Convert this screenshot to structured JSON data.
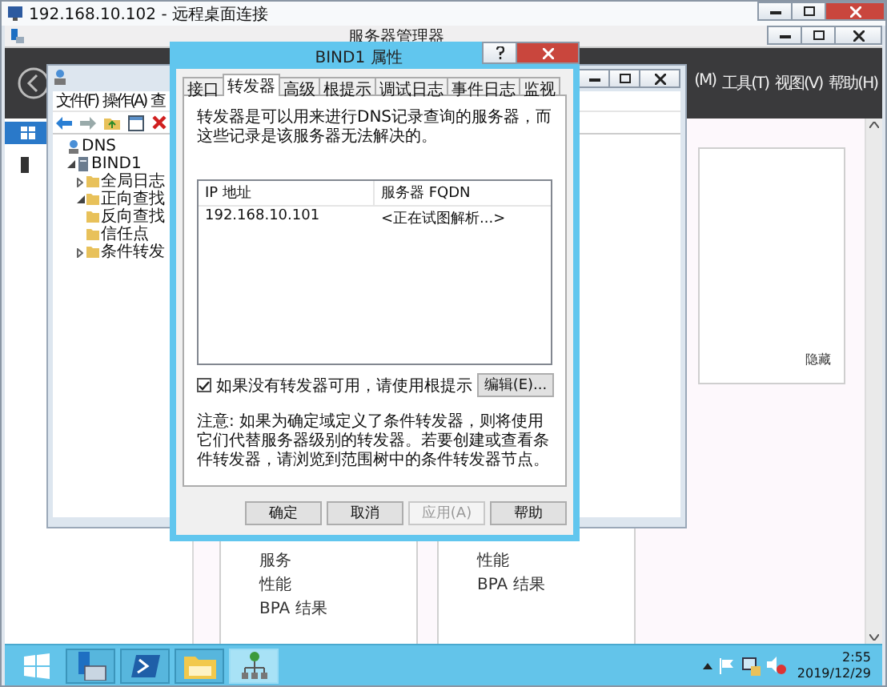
{
  "remote_window": {
    "title": "192.168.10.102 - 远程桌面连接"
  },
  "server_manager": {
    "title": "服务器管理器",
    "menu": [
      "(M)",
      "工具(T)",
      "视图(V)",
      "帮助(H)"
    ],
    "nav": [
      {
        "kind": "dashboard",
        "selected": true
      },
      {
        "kind": "server",
        "selected": false
      }
    ],
    "hide_link": "隐藏",
    "tiles": [
      {
        "items": [
          "服务",
          "性能",
          "BPA 结果"
        ]
      },
      {
        "items": [
          "性能",
          "BPA 结果"
        ]
      }
    ]
  },
  "dns_manager": {
    "menu": [
      "文件(F)",
      "操作(A)",
      "查"
    ],
    "tree": [
      {
        "label": "DNS",
        "kind": "dns",
        "children": [
          {
            "label": "BIND1",
            "kind": "server",
            "expanded": true,
            "children": [
              {
                "label": "全局日志",
                "kind": "folder",
                "expanded": false
              },
              {
                "label": "正向查找",
                "kind": "folder",
                "expanded": true
              },
              {
                "label": "反向查找",
                "kind": "folder"
              },
              {
                "label": "信任点",
                "kind": "folder"
              },
              {
                "label": "条件转发",
                "kind": "folder",
                "expanded": false
              }
            ]
          }
        ]
      }
    ]
  },
  "dialog": {
    "title": "BIND1 属性",
    "tabs": [
      {
        "label": "接口",
        "selected": false
      },
      {
        "label": "转发器",
        "selected": true
      },
      {
        "label": "高级",
        "selected": false
      },
      {
        "label": "根提示",
        "selected": false
      },
      {
        "label": "调试日志",
        "selected": false
      },
      {
        "label": "事件日志",
        "selected": false
      },
      {
        "label": "监视",
        "selected": false
      }
    ],
    "description": "转发器是可以用来进行DNS记录查询的服务器，而这些记录是该服务器无法解决的。",
    "table": {
      "columns": [
        "IP 地址",
        "服务器 FQDN"
      ],
      "rows": [
        [
          "192.168.10.101",
          "<正在试图解析...>"
        ]
      ]
    },
    "use_root_hints": {
      "label": "如果没有转发器可用，请使用根提示",
      "checked": true
    },
    "edit_button": "编辑(E)...",
    "note": "注意: 如果为确定域定义了条件转发器，则将使用它们代替服务器级别的转发器。若要创建或查看条件转发器，请浏览到范围树中的条件转发器节点。",
    "buttons": [
      {
        "label": "确定",
        "disabled": false
      },
      {
        "label": "取消",
        "disabled": false
      },
      {
        "label": "应用(A)",
        "disabled": true
      },
      {
        "label": "帮助",
        "disabled": false
      }
    ]
  },
  "taskbar": {
    "apps": [
      {
        "kind": "server-manager",
        "selected": false
      },
      {
        "kind": "powershell",
        "selected": false
      },
      {
        "kind": "explorer",
        "selected": false
      },
      {
        "kind": "dns",
        "selected": true
      }
    ],
    "time": "2:55",
    "date": "2019/12/29"
  }
}
